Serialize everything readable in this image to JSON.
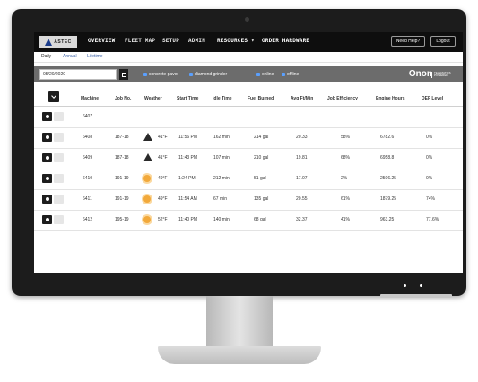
{
  "brand": {
    "logo_text": "ASTEC",
    "product_name": "Onon",
    "product_sub": "TELEMATICS POWERED"
  },
  "nav": {
    "items": [
      "OVERVIEW",
      "FLEET MAP",
      "SETUP",
      "ADMIN",
      "RESOURCES ▾",
      "ORDER HARDWARE"
    ],
    "help_label": "Need Help?",
    "logout_label": "Logout"
  },
  "subtabs": [
    "Daily",
    "Annual",
    "Lifetime"
  ],
  "filters": {
    "date_value": "05/20/2020",
    "checkbox_labels": [
      "concrete paver",
      "diamond grinder",
      "online",
      "offline"
    ]
  },
  "table": {
    "headers": [
      "Machine",
      "Job No.",
      "Weather",
      "Start Time",
      "Idle Time",
      "Fuel Burned",
      "Avg Ft/Min",
      "Job Efficiency",
      "Engine Hours",
      "DEF Level"
    ],
    "rows": [
      {
        "machine": "6407",
        "job": "",
        "weather_icon": "",
        "temp": "",
        "start": "",
        "idle": "",
        "fuel": "",
        "avg": "",
        "eff": "",
        "hours": "",
        "def": ""
      },
      {
        "machine": "6408",
        "job": "187-18",
        "weather_icon": "warning-icon",
        "temp": "41°F",
        "start": "11:56 PM",
        "idle": "162 min",
        "fuel": "214 gal",
        "avg": "20.33",
        "eff": "58%",
        "hours": "6782.6",
        "def": "0%"
      },
      {
        "machine": "6409",
        "job": "187-18",
        "weather_icon": "warning-icon",
        "temp": "41°F",
        "start": "11:43 PM",
        "idle": "107 min",
        "fuel": "210 gal",
        "avg": "19.81",
        "eff": "68%",
        "hours": "6958.8",
        "def": "0%"
      },
      {
        "machine": "6410",
        "job": "191-19",
        "weather_icon": "sun-icon",
        "temp": "49°F",
        "start": "1:24 PM",
        "idle": "212 min",
        "fuel": "51 gal",
        "avg": "17.07",
        "eff": "2%",
        "hours": "2506.25",
        "def": "0%"
      },
      {
        "machine": "6411",
        "job": "191-19",
        "weather_icon": "sun-icon",
        "temp": "49°F",
        "start": "11:54 AM",
        "idle": "67 min",
        "fuel": "135 gal",
        "avg": "20.55",
        "eff": "61%",
        "hours": "1879.25",
        "def": "74%"
      },
      {
        "machine": "6412",
        "job": "195-19",
        "weather_icon": "sun-icon",
        "temp": "52°F",
        "start": "11:40 PM",
        "idle": "140 min",
        "fuel": "68 gal",
        "avg": "32.37",
        "eff": "41%",
        "hours": "963.25",
        "def": "77.6%"
      }
    ]
  },
  "colors": {
    "nav_bg": "#0e0e0e",
    "filter_bg": "#6c6c6c",
    "link": "#3d63a8",
    "sun": "#f2a93b"
  }
}
